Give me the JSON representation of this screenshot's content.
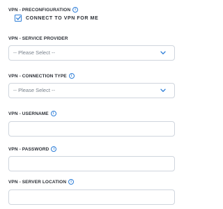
{
  "form": {
    "preconfiguration": {
      "label": "VPN - PRECONFIGURATION",
      "checkbox_label": "CONNECT TO VPN FOR ME",
      "checked": true
    },
    "service_provider": {
      "label": "VPN - SERVICE PROVIDER",
      "value": "-- Please Select --"
    },
    "connection_type": {
      "label": "VPN - CONNECTION TYPE",
      "value": "-- Please Select --"
    },
    "username": {
      "label": "VPN - USERNAME",
      "value": ""
    },
    "password": {
      "label": "VPN - PASSWORD",
      "value": ""
    },
    "server_location": {
      "label": "VPN - SERVER LOCATION",
      "value": ""
    }
  },
  "icons": {
    "info": "info-icon",
    "chevron": "chevron-down-icon",
    "check": "checkmark-icon"
  },
  "colors": {
    "accent": "#2f7fd8",
    "border": "#cfd5dd",
    "text": "#2b2f36",
    "placeholder": "#7a828c"
  },
  "glyphs": {
    "info": "i"
  }
}
